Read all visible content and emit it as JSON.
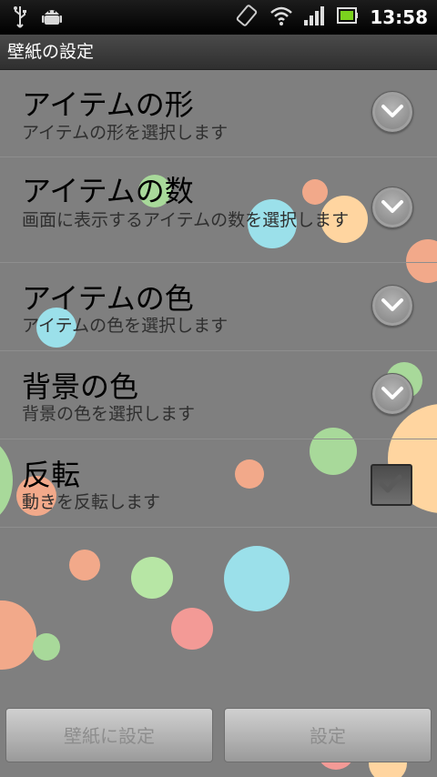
{
  "status_bar": {
    "time": "13:58",
    "left_icons": [
      "usb-icon",
      "android-icon"
    ],
    "right_icons": [
      "rotation-icon",
      "wifi-icon",
      "signal-icon",
      "battery-icon"
    ]
  },
  "title_bar": {
    "title": "壁紙の設定"
  },
  "settings": [
    {
      "title": "アイテムの形",
      "summary": "アイテムの形を選択します",
      "control": "dropdown"
    },
    {
      "title": "アイテムの数",
      "summary": "画面に表示するアイテムの数を選択します",
      "control": "dropdown"
    },
    {
      "title": "アイテムの色",
      "summary": "アイテムの色を選択します",
      "control": "dropdown"
    },
    {
      "title": "背景の色",
      "summary": "背景の色を選択します",
      "control": "dropdown"
    },
    {
      "title": "反転",
      "summary": "動きを反転します",
      "control": "checkbox",
      "checked": true
    }
  ],
  "buttons": {
    "set_wallpaper": "壁紙に設定",
    "settings": "設定"
  },
  "colors": {
    "background": "#7f7f7f",
    "bubble_palette": [
      "#a8d99a",
      "#f2a98a",
      "#9be0ea",
      "#ffd5a0",
      "#f39a96",
      "#b7e6a5"
    ]
  }
}
